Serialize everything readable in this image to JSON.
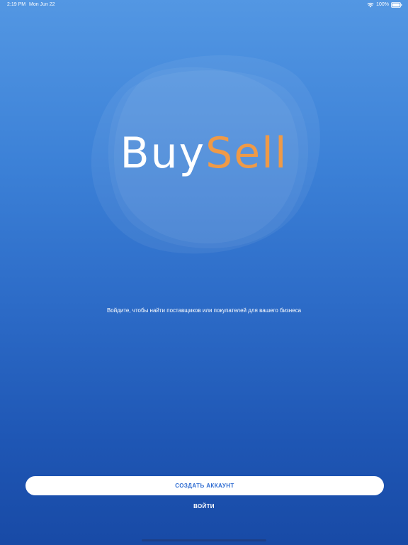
{
  "status_bar": {
    "time": "2:19 PM",
    "date": "Mon Jun 22",
    "battery": "100%",
    "icons": [
      "wifi-icon",
      "battery-icon"
    ]
  },
  "logo": {
    "part1": "Buy",
    "part2": "Sell",
    "colors": {
      "part1": "#ffffff",
      "part2": "#ef9a47"
    }
  },
  "subtitle": "Войдите, чтобы найти поставщиков или покупателей для вашего бизнеса",
  "buttons": {
    "create_account": "СОЗДАТЬ АККАУНТ",
    "login": "ВОЙТИ"
  },
  "colors": {
    "background_top": "#5397e3",
    "background_bottom": "#184aa6",
    "button_text": "#2d6bd1"
  }
}
